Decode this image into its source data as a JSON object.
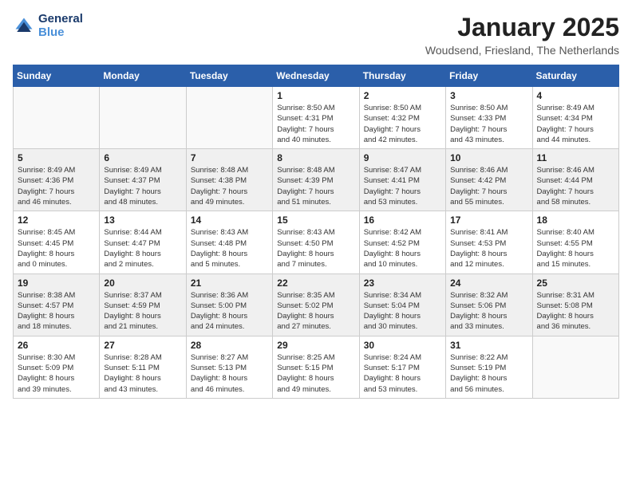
{
  "header": {
    "logo_line1": "General",
    "logo_line2": "Blue",
    "month": "January 2025",
    "location": "Woudsend, Friesland, The Netherlands"
  },
  "weekdays": [
    "Sunday",
    "Monday",
    "Tuesday",
    "Wednesday",
    "Thursday",
    "Friday",
    "Saturday"
  ],
  "weeks": [
    [
      {
        "day": "",
        "info": ""
      },
      {
        "day": "",
        "info": ""
      },
      {
        "day": "",
        "info": ""
      },
      {
        "day": "1",
        "info": "Sunrise: 8:50 AM\nSunset: 4:31 PM\nDaylight: 7 hours\nand 40 minutes."
      },
      {
        "day": "2",
        "info": "Sunrise: 8:50 AM\nSunset: 4:32 PM\nDaylight: 7 hours\nand 42 minutes."
      },
      {
        "day": "3",
        "info": "Sunrise: 8:50 AM\nSunset: 4:33 PM\nDaylight: 7 hours\nand 43 minutes."
      },
      {
        "day": "4",
        "info": "Sunrise: 8:49 AM\nSunset: 4:34 PM\nDaylight: 7 hours\nand 44 minutes."
      }
    ],
    [
      {
        "day": "5",
        "info": "Sunrise: 8:49 AM\nSunset: 4:36 PM\nDaylight: 7 hours\nand 46 minutes."
      },
      {
        "day": "6",
        "info": "Sunrise: 8:49 AM\nSunset: 4:37 PM\nDaylight: 7 hours\nand 48 minutes."
      },
      {
        "day": "7",
        "info": "Sunrise: 8:48 AM\nSunset: 4:38 PM\nDaylight: 7 hours\nand 49 minutes."
      },
      {
        "day": "8",
        "info": "Sunrise: 8:48 AM\nSunset: 4:39 PM\nDaylight: 7 hours\nand 51 minutes."
      },
      {
        "day": "9",
        "info": "Sunrise: 8:47 AM\nSunset: 4:41 PM\nDaylight: 7 hours\nand 53 minutes."
      },
      {
        "day": "10",
        "info": "Sunrise: 8:46 AM\nSunset: 4:42 PM\nDaylight: 7 hours\nand 55 minutes."
      },
      {
        "day": "11",
        "info": "Sunrise: 8:46 AM\nSunset: 4:44 PM\nDaylight: 7 hours\nand 58 minutes."
      }
    ],
    [
      {
        "day": "12",
        "info": "Sunrise: 8:45 AM\nSunset: 4:45 PM\nDaylight: 8 hours\nand 0 minutes."
      },
      {
        "day": "13",
        "info": "Sunrise: 8:44 AM\nSunset: 4:47 PM\nDaylight: 8 hours\nand 2 minutes."
      },
      {
        "day": "14",
        "info": "Sunrise: 8:43 AM\nSunset: 4:48 PM\nDaylight: 8 hours\nand 5 minutes."
      },
      {
        "day": "15",
        "info": "Sunrise: 8:43 AM\nSunset: 4:50 PM\nDaylight: 8 hours\nand 7 minutes."
      },
      {
        "day": "16",
        "info": "Sunrise: 8:42 AM\nSunset: 4:52 PM\nDaylight: 8 hours\nand 10 minutes."
      },
      {
        "day": "17",
        "info": "Sunrise: 8:41 AM\nSunset: 4:53 PM\nDaylight: 8 hours\nand 12 minutes."
      },
      {
        "day": "18",
        "info": "Sunrise: 8:40 AM\nSunset: 4:55 PM\nDaylight: 8 hours\nand 15 minutes."
      }
    ],
    [
      {
        "day": "19",
        "info": "Sunrise: 8:38 AM\nSunset: 4:57 PM\nDaylight: 8 hours\nand 18 minutes."
      },
      {
        "day": "20",
        "info": "Sunrise: 8:37 AM\nSunset: 4:59 PM\nDaylight: 8 hours\nand 21 minutes."
      },
      {
        "day": "21",
        "info": "Sunrise: 8:36 AM\nSunset: 5:00 PM\nDaylight: 8 hours\nand 24 minutes."
      },
      {
        "day": "22",
        "info": "Sunrise: 8:35 AM\nSunset: 5:02 PM\nDaylight: 8 hours\nand 27 minutes."
      },
      {
        "day": "23",
        "info": "Sunrise: 8:34 AM\nSunset: 5:04 PM\nDaylight: 8 hours\nand 30 minutes."
      },
      {
        "day": "24",
        "info": "Sunrise: 8:32 AM\nSunset: 5:06 PM\nDaylight: 8 hours\nand 33 minutes."
      },
      {
        "day": "25",
        "info": "Sunrise: 8:31 AM\nSunset: 5:08 PM\nDaylight: 8 hours\nand 36 minutes."
      }
    ],
    [
      {
        "day": "26",
        "info": "Sunrise: 8:30 AM\nSunset: 5:09 PM\nDaylight: 8 hours\nand 39 minutes."
      },
      {
        "day": "27",
        "info": "Sunrise: 8:28 AM\nSunset: 5:11 PM\nDaylight: 8 hours\nand 43 minutes."
      },
      {
        "day": "28",
        "info": "Sunrise: 8:27 AM\nSunset: 5:13 PM\nDaylight: 8 hours\nand 46 minutes."
      },
      {
        "day": "29",
        "info": "Sunrise: 8:25 AM\nSunset: 5:15 PM\nDaylight: 8 hours\nand 49 minutes."
      },
      {
        "day": "30",
        "info": "Sunrise: 8:24 AM\nSunset: 5:17 PM\nDaylight: 8 hours\nand 53 minutes."
      },
      {
        "day": "31",
        "info": "Sunrise: 8:22 AM\nSunset: 5:19 PM\nDaylight: 8 hours\nand 56 minutes."
      },
      {
        "day": "",
        "info": ""
      }
    ]
  ]
}
